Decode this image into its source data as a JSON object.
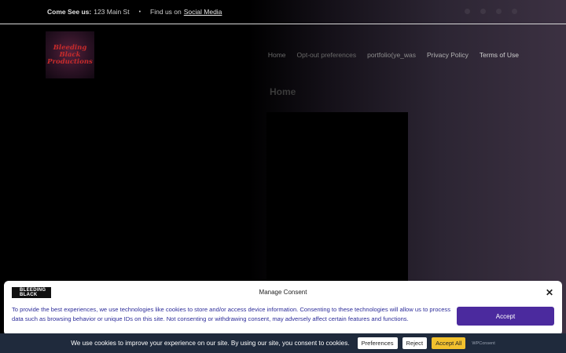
{
  "topbar": {
    "visit_label": "Come See us:",
    "address": "123 Main St",
    "separator": "•",
    "find_prefix": "Find us on",
    "social_link": "Social Media"
  },
  "header": {
    "logo_text": "Bleeding Black Productions",
    "nav": [
      "Home",
      "Opt-out preferences",
      "portfolio(ye_was",
      "Privacy Policy",
      "Terms of Use"
    ]
  },
  "main": {
    "title": "Home"
  },
  "consent": {
    "logo_text": "BLEEDING BLACK",
    "title": "Manage Consent",
    "close": "✕",
    "text": "To provide the best experiences, we use technologies like cookies to store and/or access device information. Consenting to these technologies will allow us to process data such as browsing behavior or unique IDs on this site. Not consenting or withdrawing consent, may adversely affect certain features and functions.",
    "accept_label": "Accept"
  },
  "cookie_bar": {
    "message": "We use cookies to improve your experience on our site. By using our site, you consent to cookies.",
    "preferences_label": "Preferences",
    "reject_label": "Reject",
    "accept_all_label": "Accept All",
    "brand": "WPConsent"
  },
  "colors": {
    "accept_button": "#4b2a9e",
    "accept_all_button": "#f2c12e",
    "cookie_bar_bg": "#1f2a3c"
  }
}
